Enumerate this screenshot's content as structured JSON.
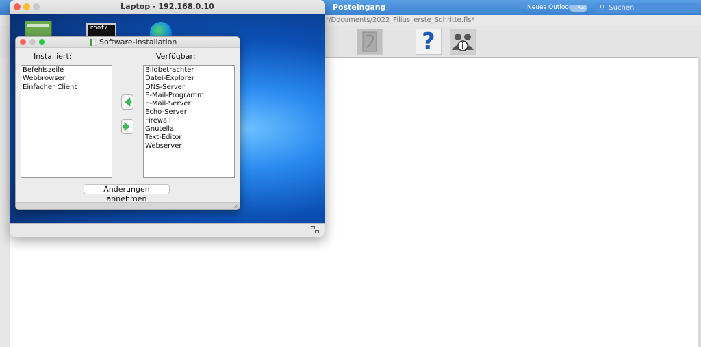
{
  "outlook": {
    "title": "Posteingang",
    "new_outlook_label": "Neues Outlook",
    "toggle_label": "Aus",
    "search_placeholder": "Suchen"
  },
  "filius": {
    "path": "r/Documents/2022_Filius_erste_Schritte.fls*",
    "toolbar": {
      "help_glyph": "?"
    }
  },
  "laptop": {
    "title": "Laptop - 192.168.0.10",
    "desktop_icons": [
      {
        "name": "software-installation-icon",
        "label": ""
      },
      {
        "name": "terminal-icon",
        "label": "root/"
      },
      {
        "name": "webbrowser-icon",
        "label": ""
      }
    ]
  },
  "dialog": {
    "title": "Software-Installation",
    "installed_label": "Installiert:",
    "available_label": "Verfügbar:",
    "installed": [
      "Befehlszeile",
      "Webbrowser",
      "Einfacher Client"
    ],
    "available": [
      "Bildbetrachter",
      "Datei-Explorer",
      "DNS-Server",
      "E-Mail-Programm",
      "E-Mail-Server",
      "Echo-Server",
      "Firewall",
      "Gnutella",
      "Text-Editor",
      "Webserver"
    ],
    "apply_label": "Änderungen annehmen"
  },
  "colors": {
    "close": "#fc5f57",
    "minimize": "#fdbc2e",
    "maximize": "#28c840",
    "inactive": "#c8c8c8",
    "accent": "#3b82d2",
    "arrow_green": "#3cc25a"
  }
}
